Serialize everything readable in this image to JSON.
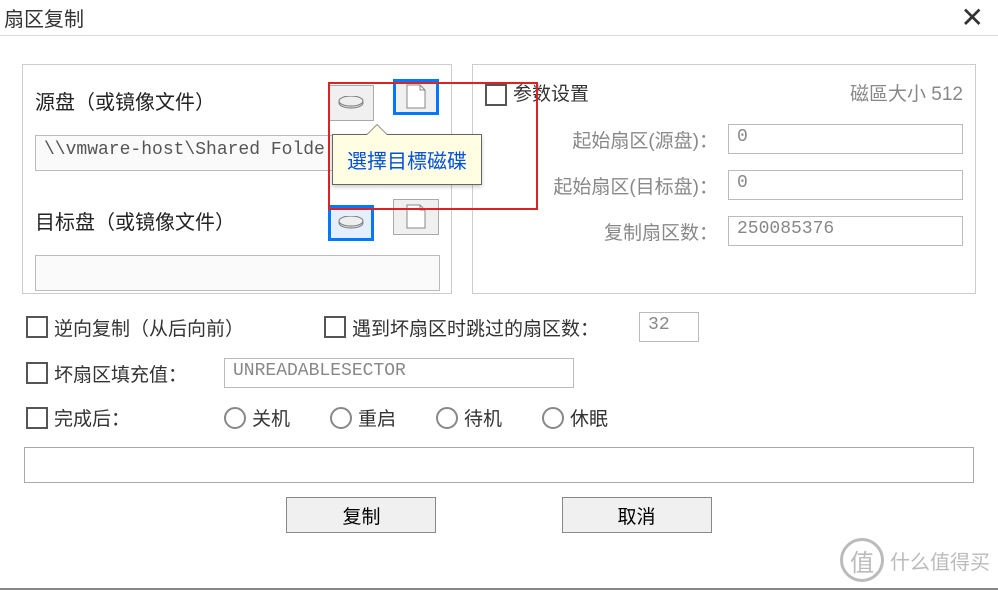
{
  "window": {
    "title": "扇区复制"
  },
  "source": {
    "label": "源盘（或镜像文件）",
    "path": "\\\\vmware-host\\Shared Folde"
  },
  "target": {
    "label": "目标盘（或镜像文件）",
    "path": ""
  },
  "tooltip": {
    "text": "選擇目標磁碟"
  },
  "params": {
    "title": "参数设置",
    "sectorSizeLabel": "磁區大小 512",
    "startSrcLabel": "起始扇区(源盘)：",
    "startSrcValue": "0",
    "startDstLabel": "起始扇区(目标盘)：",
    "startDstValue": "0",
    "copyCountLabel": "复制扇区数：",
    "copyCountValue": "250085376"
  },
  "options": {
    "reverse": "逆向复制（从后向前）",
    "skipBadLabel": "遇到坏扇区时跳过的扇区数：",
    "skipBadValue": "32",
    "fillLabel": "坏扇区填充值：",
    "fillValue": "UNREADABLESECTOR",
    "afterLabel": "完成后：",
    "afterOptions": [
      "关机",
      "重启",
      "待机",
      "休眠"
    ]
  },
  "buttons": {
    "copy": "复制",
    "cancel": "取消"
  },
  "watermark": {
    "text": "什么值得买",
    "badge": "值"
  }
}
